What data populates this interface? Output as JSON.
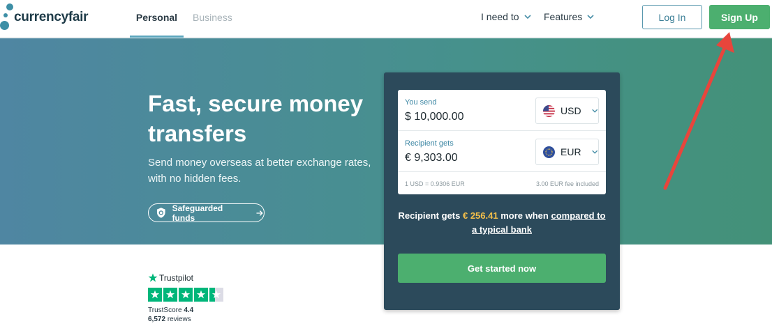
{
  "header": {
    "logo_text": "currencyfair",
    "tabs": [
      {
        "label": "Personal",
        "active": true
      },
      {
        "label": "Business",
        "active": false
      }
    ],
    "menus": [
      {
        "label": "I need to",
        "icon": "chevron-down-icon"
      },
      {
        "label": "Features",
        "icon": "chevron-down-icon"
      }
    ],
    "login_label": "Log In",
    "signup_label": "Sign Up"
  },
  "hero": {
    "title": "Fast, secure money transfers",
    "subtitle": "Send money overseas at better exchange rates, with no hidden fees.",
    "safeguard_label": "Safeguarded funds"
  },
  "converter": {
    "send_label": "You send",
    "send_amount": "$ 10,000.00",
    "send_currency": "USD",
    "recv_label": "Recipient gets",
    "recv_amount": "€ 9,303.00",
    "recv_currency": "EUR",
    "rate": "1 USD = 0.9306 EUR",
    "fee": "3.00 EUR fee included",
    "saving_prefix": "Recipient gets",
    "saving_amount": "€ 256.41",
    "saving_middle": "more when",
    "saving_link": "compared to a typical bank",
    "cta_label": "Get started now"
  },
  "trustpilot": {
    "brand": "Trustpilot",
    "score_label": "TrustScore",
    "score": "4.4",
    "rating": 4.4,
    "reviews_count": "6,572",
    "reviews_label": "reviews"
  },
  "colors": {
    "accent_green": "#4caf6f",
    "card_bg": "#2c4a5b",
    "annotation_red": "#e8453c",
    "trustpilot_green": "#00b67a"
  }
}
